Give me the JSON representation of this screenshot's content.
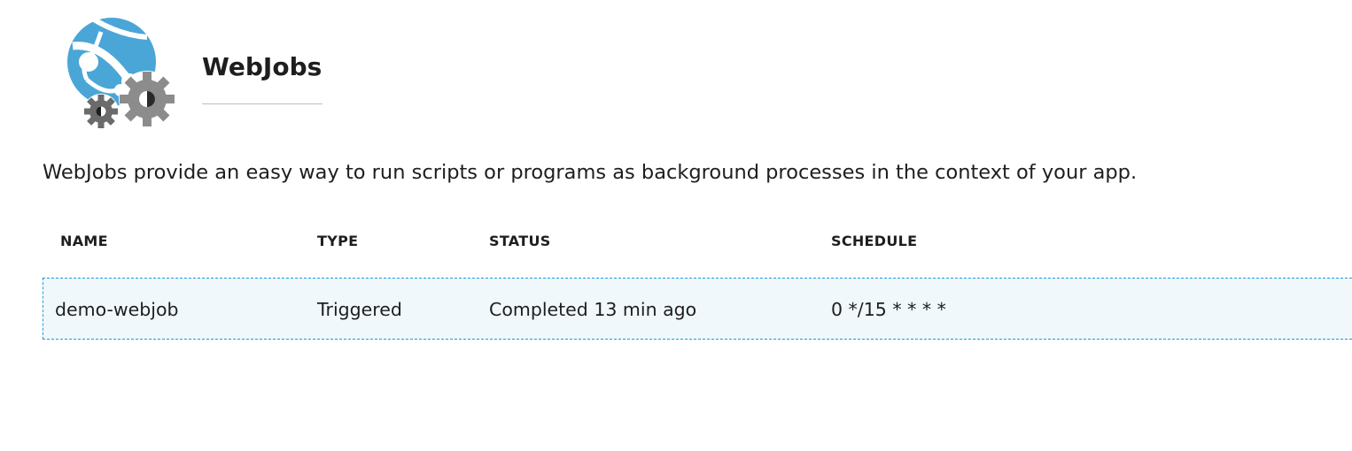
{
  "header": {
    "title": "WebJobs",
    "logo_icon": "webjobs-globe-gears-icon"
  },
  "description": "WebJobs provide an easy way to run scripts or programs as background processes in the context of your app.",
  "table": {
    "columns": [
      "NAME",
      "TYPE",
      "STATUS",
      "SCHEDULE"
    ],
    "rows": [
      {
        "name": "demo-webjob",
        "type": "Triggered",
        "status": "Completed 13 min ago",
        "schedule": "0 */15 * * * *"
      }
    ]
  },
  "colors": {
    "globe_blue": "#4aa6d6",
    "gear_dark": "#6b6b6b",
    "gear_light": "#8c8c8c",
    "selection_border": "#1a9bd7",
    "selection_fill": "#f1f8fb"
  }
}
